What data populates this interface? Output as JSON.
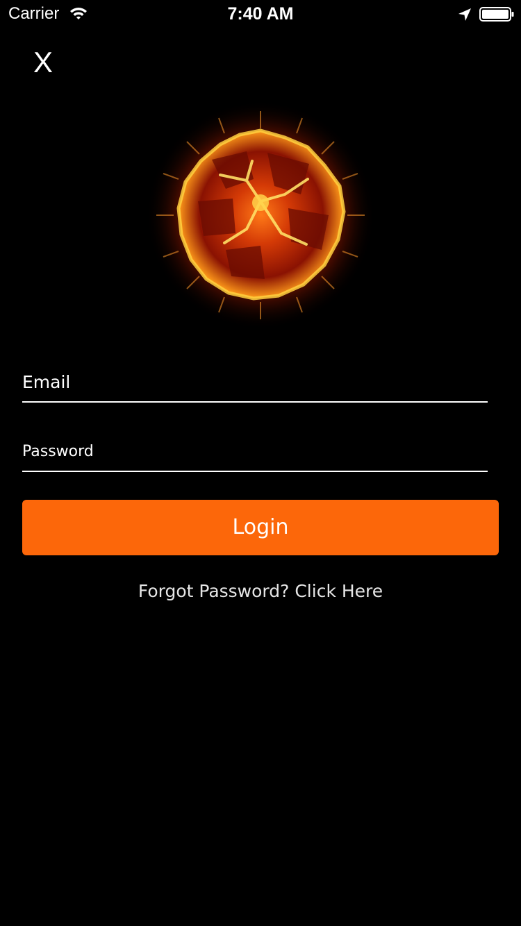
{
  "status_bar": {
    "carrier": "Carrier",
    "time": "7:40 AM",
    "icons": [
      "wifi-icon",
      "location-arrow-icon",
      "battery-icon"
    ]
  },
  "header": {
    "close_label": "X"
  },
  "logo": {
    "icon": "fire-explosion-logo"
  },
  "form": {
    "email_placeholder": "Email",
    "email_value": "",
    "password_placeholder": "Password",
    "password_value": "",
    "login_label": "Login",
    "forgot_label": "Forgot Password? Click Here"
  },
  "colors": {
    "background": "#000000",
    "accent": "#fc670a",
    "text": "#ffffff"
  }
}
